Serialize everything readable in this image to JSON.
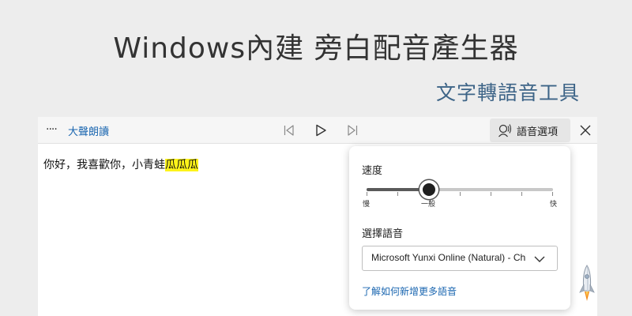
{
  "header": {
    "title": "Windows內建  旁白配音產生器",
    "subtitle": "文字轉語音工具"
  },
  "toolbar": {
    "more_glyph": "····",
    "read_aloud_label": "大聲朗讀",
    "previous_icon": "skip-previous-icon",
    "play_icon": "play-icon",
    "next_icon": "skip-next-icon",
    "voice_options_label": "語音選項",
    "close_icon": "close-icon"
  },
  "content": {
    "text_before": "你好，我喜歡你，小青蛙",
    "text_highlighted": "瓜瓜瓜"
  },
  "voice_panel": {
    "speed_label": "速度",
    "speed_value": 0.333,
    "speed_min_label": "慢",
    "speed_mid_label": "一般",
    "speed_max_label": "快",
    "select_voice_label": "選擇語音",
    "selected_voice": "Microsoft Yunxi Online (Natural) - Chinese (Mainland)",
    "learn_more_link": "了解如何新增更多語音"
  },
  "colors": {
    "background": "#ededed",
    "title": "#333333",
    "subtitle": "#3d6487",
    "link": "#1a66b0",
    "highlight": "#fdf31a"
  }
}
